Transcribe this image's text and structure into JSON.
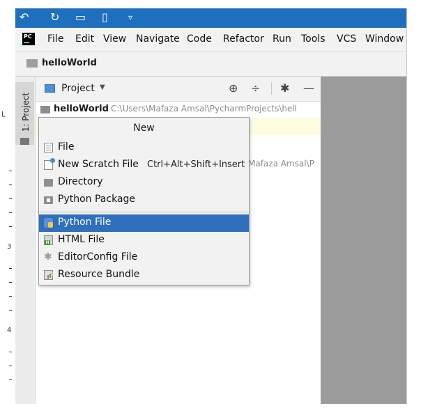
{
  "quick_access": {
    "undo_icon": "↶",
    "redo_icon": "↻",
    "open_icon": "▭",
    "new_icon": "▯",
    "more_icon": "▿"
  },
  "menubar": {
    "items": [
      "File",
      "Edit",
      "View",
      "Navigate",
      "Code",
      "Refactor",
      "Run",
      "Tools",
      "VCS",
      "Window"
    ]
  },
  "navbar": {
    "project_name": "helloWorld"
  },
  "tool_stripe": {
    "label": "1: Project",
    "ruler_numbers": [
      "3",
      "4"
    ]
  },
  "project_panel": {
    "title": "Project",
    "caret": "▼",
    "icons": {
      "locate": "⊕",
      "collapse": "÷",
      "settings": "✱",
      "hide": "—"
    },
    "tree": {
      "root_name": "helloWorld",
      "root_path": "C:\\Users\\Mafaza Amsal\\PycharmProjects\\hell"
    },
    "partial_path": "Mafaza Amsal\\P"
  },
  "popup": {
    "title": "New",
    "items": [
      {
        "label": "File",
        "shortcut": "",
        "icon": "file-icon"
      },
      {
        "label": "New Scratch File",
        "shortcut": "Ctrl+Alt+Shift+Insert",
        "icon": "scratch-file-icon"
      },
      {
        "label": "Directory",
        "shortcut": "",
        "icon": "folder-icon"
      },
      {
        "label": "Python Package",
        "shortcut": "",
        "icon": "python-package-icon"
      },
      {
        "label": "Python File",
        "shortcut": "",
        "icon": "python-file-icon",
        "selected": true
      },
      {
        "label": "HTML File",
        "shortcut": "",
        "icon": "html-file-icon"
      },
      {
        "label": "EditorConfig File",
        "shortcut": "",
        "icon": "editorconfig-icon"
      },
      {
        "label": "Resource Bundle",
        "shortcut": "",
        "icon": "resource-bundle-icon"
      }
    ]
  },
  "colors": {
    "accent": "#2f6fbd",
    "title_blue": "#1f6fbd",
    "editor_gray": "#9b9b9b"
  }
}
